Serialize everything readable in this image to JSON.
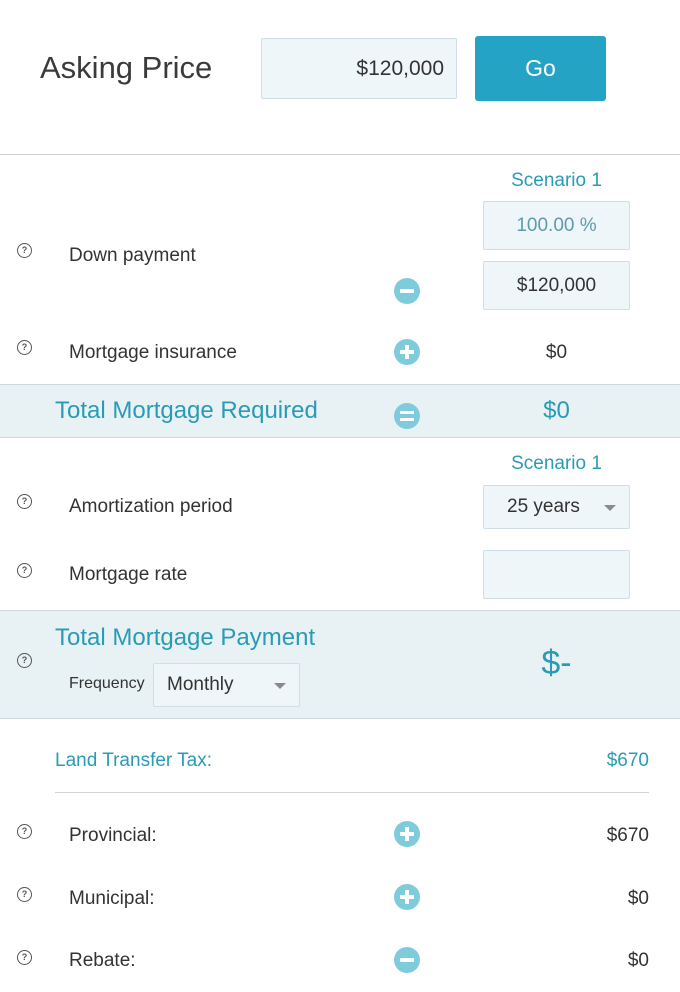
{
  "asking_price": {
    "label": "Asking Price",
    "value": "$120,000",
    "go_label": "Go"
  },
  "mortgage_section": {
    "scenario_label": "Scenario 1",
    "down_payment": {
      "label": "Down payment",
      "percent": "100.00 %",
      "amount": "$120,000"
    },
    "mortgage_insurance": {
      "label": "Mortgage insurance",
      "value": "$0"
    },
    "total_required": {
      "label": "Total Mortgage Required",
      "value": "$0"
    }
  },
  "payment_section": {
    "scenario_label": "Scenario 1",
    "amortization": {
      "label": "Amortization period",
      "selected": "25 years"
    },
    "mortgage_rate": {
      "label": "Mortgage rate",
      "value": ""
    },
    "total_payment": {
      "label": "Total Mortgage Payment",
      "frequency_label": "Frequency",
      "frequency_selected": "Monthly",
      "value": "$-"
    }
  },
  "land_transfer": {
    "label": "Land Transfer Tax:",
    "total": "$670",
    "provincial": {
      "label": "Provincial:",
      "value": "$670"
    },
    "municipal": {
      "label": "Municipal:",
      "value": "$0"
    },
    "rebate": {
      "label": "Rebate:",
      "value": "$0"
    }
  },
  "colors": {
    "accent": "#2a9bb7",
    "button": "#24a3c5",
    "icon": "#7ecbdc",
    "band": "#e8f1f4",
    "input_bg": "#eef6f9"
  },
  "icons": {
    "help": "question-circle-icon",
    "plus": "plus-circle-icon",
    "minus": "minus-circle-icon",
    "equals": "equals-circle-icon",
    "caret": "caret-down-icon"
  }
}
